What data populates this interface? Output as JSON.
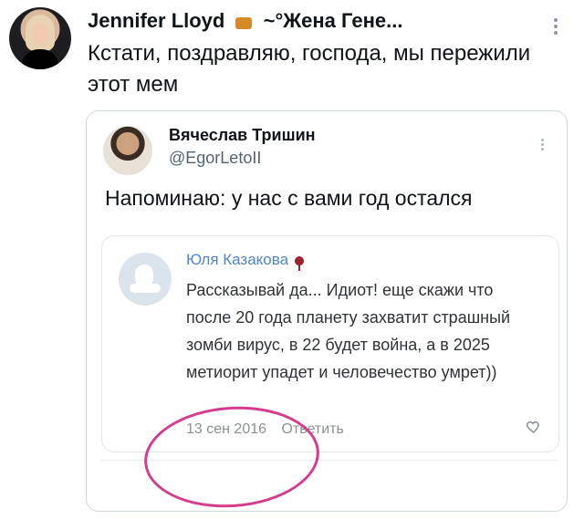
{
  "header": {
    "user_name": "Jennifer Lloyd",
    "user_note": "~°Жена Гене...",
    "tweet_text": "Кстати, поздравляю, господа, мы пережили этот мем"
  },
  "quoted_tweet": {
    "name": "Вячеслав Тришин",
    "handle": "@EgorLetoII",
    "text": "Напоминаю: у нас с вами год остался",
    "embedded_comment": {
      "name": "Юля Казакова",
      "text": "Рассказывай да... Идиот! еще скажи что после 20 года планету захватит страшный зомби вирус, в 22 будет война, а в 2025 метиорит упадет и человечество умрет))",
      "date": "13 сен 2016",
      "reply_label": "Ответить"
    }
  },
  "colors": {
    "highlight_circle": "#d63c8d",
    "comment_name": "#4f86c6"
  },
  "icons": {
    "more": "more-icon",
    "heart": "heart-icon",
    "wine": "wine-icon"
  }
}
